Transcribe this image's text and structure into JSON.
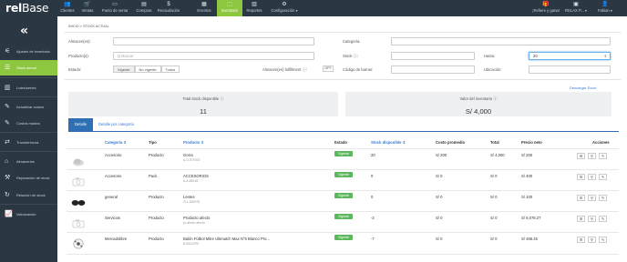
{
  "app": {
    "logo_a": "rel",
    "logo_b": "Base"
  },
  "nav": {
    "items": [
      {
        "label": "Clientes",
        "icon": "users-icon"
      },
      {
        "label": "Ventas",
        "icon": "cart-icon"
      },
      {
        "label": "Punto de venta",
        "icon": "pos-icon"
      },
      {
        "label": "Compras",
        "icon": "bag-icon"
      },
      {
        "label": "Recaudación",
        "icon": "money-icon"
      },
      {
        "label": "Eventos",
        "icon": "calendar-icon"
      },
      {
        "label": "Inventario",
        "icon": "boxes-icon"
      },
      {
        "label": "Reportes",
        "icon": "chart-icon"
      },
      {
        "label": "Configuración ▾",
        "icon": "gear-icon"
      }
    ],
    "right": [
      {
        "label": "¡Refiere y gana!",
        "icon": "gift-icon"
      },
      {
        "label": "RELAX P... ▾",
        "icon": "building-icon"
      },
      {
        "label": "Fabian ▾",
        "icon": "user-icon"
      }
    ]
  },
  "sidebar": {
    "collapse": "«",
    "items": [
      {
        "label": "Ajustes de inventario",
        "icon": "sliders-icon"
      },
      {
        "label": "Stock actual",
        "icon": "list-icon"
      },
      {
        "label": "Lotes/series",
        "icon": "barcode-icon"
      },
      {
        "label": "Actualizar costos",
        "icon": "edit-icon"
      },
      {
        "label": "Costos masivo",
        "icon": "edit-many-icon"
      },
      {
        "label": "Transferencia",
        "icon": "transfer-icon"
      },
      {
        "label": "Almacenes",
        "icon": "warehouse-icon"
      },
      {
        "label": "Reparación de stock",
        "icon": "repair-icon"
      },
      {
        "label": "Relación de stock",
        "icon": "refresh-icon"
      },
      {
        "label": "Valorización",
        "icon": "chart-line-icon"
      }
    ]
  },
  "breadcrumb": {
    "home": "INICIO",
    "sep": " > ",
    "current": "STOCK ACTUAL"
  },
  "filters": {
    "almacenes_label": "Almacen(es):",
    "productos_label": "Producto(s):",
    "productos_placeholder": "Q  Buscar",
    "estado_label": "Estado:",
    "estado_options": [
      "Vigente",
      "No vigente",
      "Todos"
    ],
    "estado_selected": "Vigente",
    "fulfilment_label": "Almacen(es) fulfillment ⓘ:",
    "fulfilment_value": "OFF",
    "categoria_label": "Categoría:",
    "stock_label": "Stock ⓘ:",
    "codigo_label": "Código de barras:",
    "hasta_label": "Hasta:",
    "hasta_value": "20",
    "ubicacion_label": "Ubicación:"
  },
  "download": {
    "label": "Descargar",
    "link": "Excel"
  },
  "stats": {
    "total_label": "Total stock disponible ⓘ",
    "total_value": "11",
    "valor_label": "Valor del inventario ⓘ",
    "valor_value": "S/ 4,000"
  },
  "tabs": {
    "detalle": "Detalle",
    "categoria": "Detalle por categoría"
  },
  "table": {
    "headers": {
      "categoria": "Categoría ⇕",
      "tipo": "Tipo",
      "producto": "Producto ⇕",
      "estado": "Estado",
      "stock": "Stock disponible ⇕",
      "costo": "Costo promedio",
      "total": "Total",
      "precio": "Precio neto",
      "acciones": "Acciones"
    },
    "rows": [
      {
        "categoria": "Accesorio",
        "tipo": "Producto",
        "producto": "Gorra",
        "sku": "A-G-570002",
        "estado": "Vigente",
        "stock": "20",
        "costo": "S/ 200",
        "total": "S/ 4,000",
        "precio": "S/ 200",
        "thumb": "cap-image"
      },
      {
        "categoria": "Accesorio",
        "tipo": "Pack",
        "producto": "ACCESORIOS",
        "sku": "A-A-88148",
        "estado": "Vigente",
        "stock": "0",
        "costo": "S/ 0",
        "total": "S/ 0",
        "precio": "S/ 400",
        "thumb": "camera-placeholder"
      },
      {
        "categoria": "general",
        "tipo": "Producto",
        "producto": "Lentes",
        "sku": "G-L-506978",
        "estado": "Vigente",
        "stock": "0",
        "costo": "S/ 0",
        "total": "S/ 0",
        "precio": "S/ 100",
        "thumb": "sunglasses-image"
      },
      {
        "categoria": "Servicios",
        "tipo": "Producto",
        "producto": "Producto afecto",
        "sku": "pr-afecto-afecto",
        "estado": "Vigente",
        "stock": "-2",
        "costo": "S/ 0",
        "total": "S/ 0",
        "precio": "S/ 5,076.27",
        "thumb": "camera-placeholder"
      },
      {
        "categoria": "Mercadolibre",
        "tipo": "Producto",
        "producto": "Balón Fútbol Mitre Ultimatch Max N°5 Blanco Pro...",
        "sku": "B-50222P5",
        "estado": "Vigente",
        "stock": "-7",
        "costo": "S/ 0",
        "total": "S/ 0",
        "precio": "S/ 466.45",
        "thumb": "ball-image"
      }
    ],
    "action_icons": [
      "list-icon",
      "location-icon",
      "edit-icon"
    ]
  },
  "colors": {
    "nav_bg": "#2c3744",
    "accent_green": "#8dc63f",
    "tab_blue": "#2f6fb3",
    "badge_green": "#5cb85c"
  }
}
